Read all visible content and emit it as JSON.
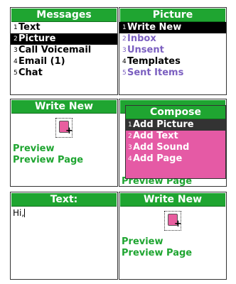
{
  "colors": {
    "title_green": "#1fa531",
    "link_green": "#1fa531",
    "menu_purple": "#7b5fc0",
    "popup_pink": "#e55aa5",
    "selected": "#000000"
  },
  "messages": {
    "title": "Messages",
    "items": [
      {
        "num": "1",
        "label": "Text"
      },
      {
        "num": "2",
        "label": "Picture"
      },
      {
        "num": "3",
        "label": "Call Voicemail"
      },
      {
        "num": "4",
        "label": "Email (1)"
      },
      {
        "num": "5",
        "label": "Chat"
      }
    ]
  },
  "picture": {
    "title": "Picture",
    "items": [
      {
        "num": "1",
        "label": "Write New"
      },
      {
        "num": "2",
        "label": "Inbox"
      },
      {
        "num": "3",
        "label": "Unsent"
      },
      {
        "num": "4",
        "label": "Templates"
      },
      {
        "num": "5",
        "label": "Sent Items"
      }
    ]
  },
  "write_new": {
    "title": "Write New",
    "icon": "picture-page-add-icon",
    "preview": "Preview",
    "preview_page": "Preview Page"
  },
  "compose": {
    "title": "Compose",
    "items": [
      {
        "num": "1",
        "label": "Add Picture"
      },
      {
        "num": "2",
        "label": "Add Text"
      },
      {
        "num": "3",
        "label": "Add Sound"
      },
      {
        "num": "4",
        "label": "Add Page"
      }
    ],
    "behind_text": "Preview Page"
  },
  "text_screen": {
    "title": "Text:",
    "value": "Hi,"
  },
  "write_new_2": {
    "title": "Write New",
    "preview": "Preview",
    "preview_page": "Preview Page"
  }
}
